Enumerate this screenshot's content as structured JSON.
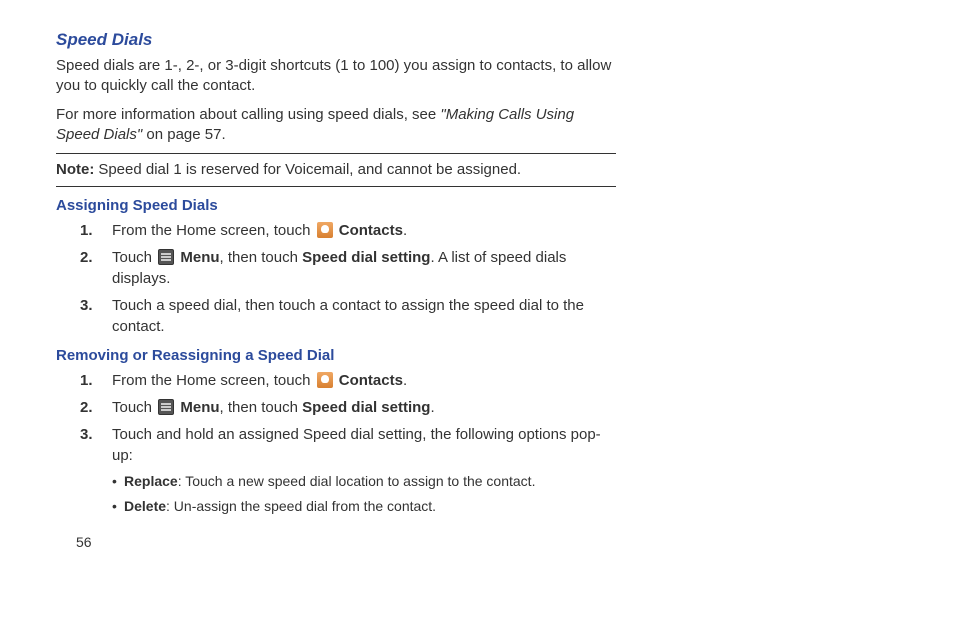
{
  "section_title": "Speed Dials",
  "intro_p1": "Speed dials are 1-, 2-, or 3-digit shortcuts (1 to 100) you assign to contacts, to allow you to quickly call the contact.",
  "intro_p2a": "For more information about calling using speed dials, see ",
  "intro_p2_italic": "\"Making Calls Using Speed Dials\"",
  "intro_p2b": " on page 57.",
  "note_label": "Note:",
  "note_text": "Speed dial 1 is reserved for Voicemail, and cannot be assigned.",
  "assign_heading": "Assigning Speed Dials",
  "assign": {
    "s1a": "From the Home screen, touch ",
    "s1b": "Contacts",
    "s1c": ".",
    "s2a": "Touch ",
    "s2b": "Menu",
    "s2c": ", then touch ",
    "s2d": "Speed dial setting",
    "s2e": ". A list of speed dials displays.",
    "s3": "Touch a speed dial, then touch a contact to assign the speed dial to the contact."
  },
  "remove_heading": "Removing or Reassigning a Speed Dial",
  "remove": {
    "s1a": "From the Home screen, touch ",
    "s1b": "Contacts",
    "s1c": ".",
    "s2a": "Touch ",
    "s2b": "Menu",
    "s2c": ", then touch ",
    "s2d": "Speed dial setting",
    "s2e": ".",
    "s3": "Touch and hold an assigned Speed dial setting, the following options pop-up:",
    "b1_label": "Replace",
    "b1_text": ": Touch a new speed dial location to assign to the contact.",
    "b2_label": "Delete",
    "b2_text": ": Un-assign the speed dial from the contact."
  },
  "page_number": "56"
}
